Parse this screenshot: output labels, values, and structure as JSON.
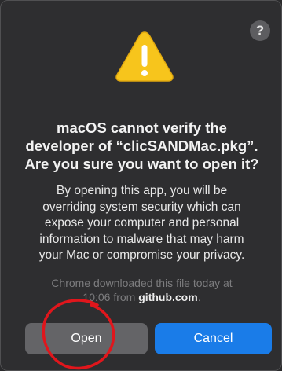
{
  "dialog": {
    "help_label": "?",
    "icon": "warning-triangle-icon",
    "title_lines": [
      "macOS cannot verify the",
      "developer of “clicSANDMac.pkg”.",
      "Are you sure you want to open it?"
    ],
    "body_lines": [
      "By opening this app, you will be",
      "overriding system security which can",
      "expose your computer and personal",
      "information to malware that may harm",
      "your Mac or compromise your privacy."
    ],
    "source_line1": "Chrome downloaded this file today at",
    "source_time": "10:06 from ",
    "source_domain": "github.com",
    "source_end": ".",
    "open_label": "Open",
    "cancel_label": "Cancel"
  },
  "colors": {
    "accent": "#1a7ce8",
    "warning": "#f7c51c",
    "annotation": "#e0161c"
  }
}
